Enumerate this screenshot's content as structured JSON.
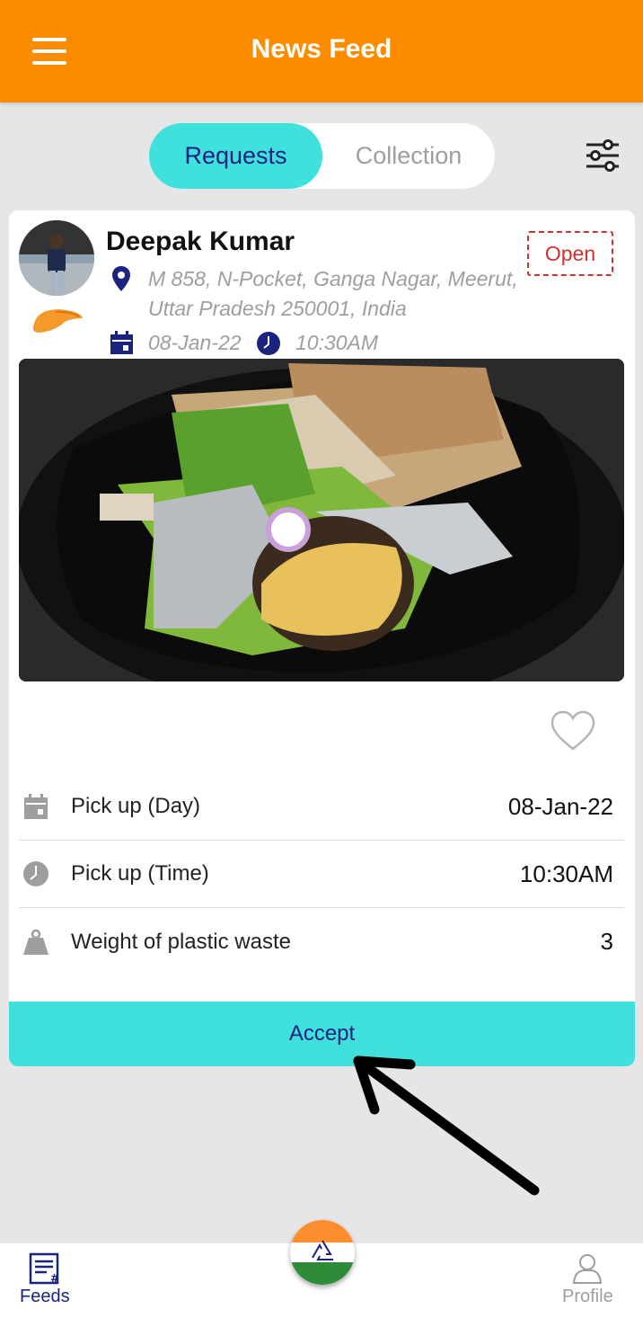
{
  "header": {
    "title": "News Feed",
    "menu_icon": "hamburger-menu-icon"
  },
  "tabs": [
    {
      "label": "Requests",
      "active": true
    },
    {
      "label": "Collection",
      "active": false
    }
  ],
  "filter_icon": "sliders-icon",
  "feed_card": {
    "user_name": "Deepak Kumar",
    "status": "Open",
    "address_line1": "M 858, N-Pocket, Ganga Nagar, Meerut,",
    "address_line2": "Uttar Pradesh 250001, India",
    "date": "08-Jan-22",
    "time": "10:30AM",
    "details": [
      {
        "icon": "calendar-icon",
        "label": "Pick up (Day)",
        "value": "08-Jan-22"
      },
      {
        "icon": "clock-icon",
        "label": "Pick up (Time)",
        "value": "10:30AM"
      },
      {
        "icon": "weight-icon",
        "label": "Weight of plastic waste",
        "value": "3"
      }
    ],
    "accept_label": "Accept"
  },
  "bottom_nav": {
    "feeds_label": "Feeds",
    "profile_label": "Profile",
    "center_icon": "recycle-icon"
  },
  "colors": {
    "header": "#fb8c00",
    "accent": "#40e0dc",
    "primary_text": "#1a237e",
    "status": "#d32f2f"
  }
}
